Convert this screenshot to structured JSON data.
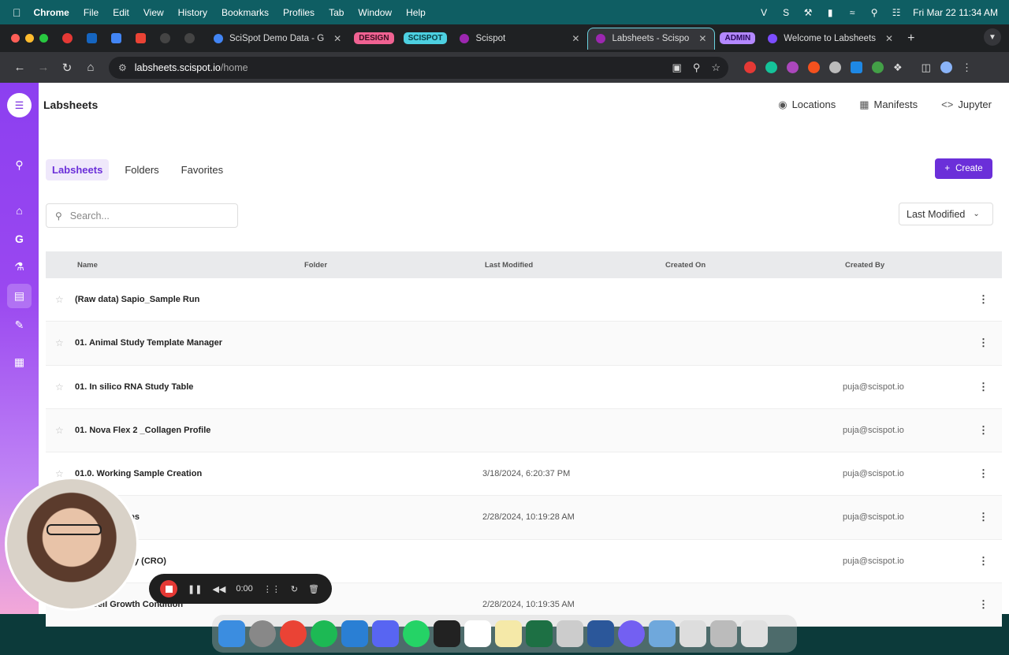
{
  "menubar": {
    "app_name": "Chrome",
    "items": [
      "File",
      "Edit",
      "View",
      "History",
      "Bookmarks",
      "Profiles",
      "Tab",
      "Window",
      "Help"
    ],
    "clock": "Fri Mar 22  11:34 AM"
  },
  "tabs": [
    {
      "label": "SciSpot Demo Data - G",
      "fav_color": "#4285f4"
    },
    {
      "group": "DESIGN",
      "group_color": "#f06292"
    },
    {
      "group": "SCISPOT",
      "group_color": "#4dd0e1"
    },
    {
      "label": "Scispot",
      "fav_color": "#9c27b0"
    },
    {
      "label": "Labsheets - Scispo",
      "fav_color": "#9c27b0",
      "active": true
    },
    {
      "group": "ADMIN",
      "group_color": "#b388ff"
    },
    {
      "label": "Welcome to Labsheets",
      "fav_color": "#7c4dff"
    }
  ],
  "address": {
    "host": "labsheets.scispot.io",
    "path": "/home"
  },
  "app": {
    "brand": "Labsheets",
    "topnav": {
      "locations": "Locations",
      "manifests": "Manifests",
      "jupyter": "Jupyter"
    },
    "tabs": {
      "labsheets": "Labsheets",
      "folders": "Folders",
      "favorites": "Favorites"
    },
    "create_label": "Create",
    "search_placeholder": "Search...",
    "sort_label": "Last Modified",
    "columns": {
      "name": "Name",
      "folder": "Folder",
      "last_modified": "Last Modified",
      "created_on": "Created On",
      "created_by": "Created By"
    },
    "rows": [
      {
        "name": "(Raw data) Sapio_Sample Run",
        "last_modified": "",
        "created_by": ""
      },
      {
        "name": "01. Animal Study Template Manager",
        "last_modified": "",
        "created_by": ""
      },
      {
        "name": "01. In silico RNA Study Table",
        "last_modified": "",
        "created_by": "puja@scispot.io"
      },
      {
        "name": "01. Nova Flex 2 _Collagen Profile",
        "last_modified": "",
        "created_by": "puja@scispot.io"
      },
      {
        "name": "01.0. Working Sample Creation",
        "last_modified": "3/18/2024, 6:20:37 PM",
        "created_by": "puja@scispot.io"
      },
      {
        "name": "ges",
        "last_modified": "2/28/2024, 10:19:28 AM",
        "created_by": "puja@scispot.io"
      },
      {
        "name": "y (CRO)",
        "last_modified": "",
        "created_by": "puja@scispot.io"
      },
      {
        "name": "Cell Growth Condition",
        "last_modified": "2/28/2024, 10:19:35 AM",
        "created_by": ""
      }
    ]
  },
  "recorder": {
    "time": "0:00"
  }
}
